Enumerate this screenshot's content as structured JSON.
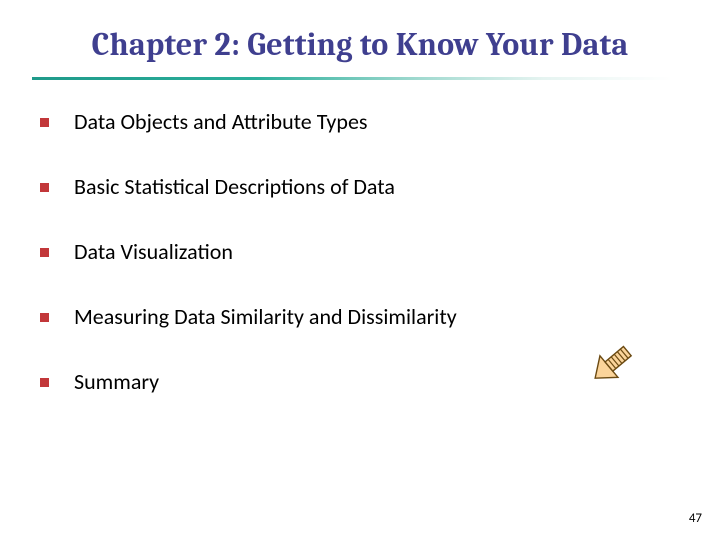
{
  "title": "Chapter 2: Getting to Know Your Data",
  "bullets": [
    "Data Objects and Attribute Types",
    "Basic Statistical Descriptions of Data",
    "Data Visualization",
    "Measuring Data Similarity and Dissimilarity",
    "Summary"
  ],
  "page_number": "47"
}
